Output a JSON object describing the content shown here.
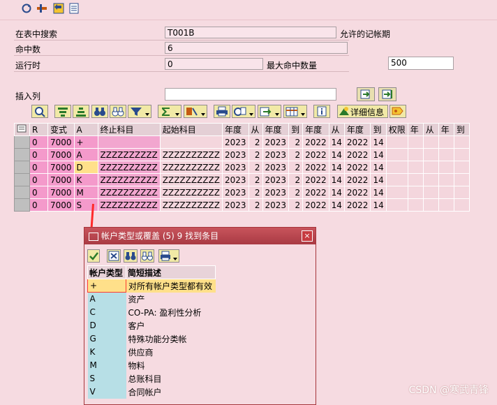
{
  "toolbar_icons": [
    "refresh-icon",
    "tools-icon",
    "back-icon",
    "list-icon"
  ],
  "form": {
    "search_label": "在表中搜索",
    "search_value": "T001B",
    "allowed_period_label": "允许的记帐期",
    "hits_label": "命中数",
    "hits_value": "6",
    "runtime_label": "运行时",
    "runtime_value": "0",
    "max_hits_label": "最大命中数量",
    "max_hits_value": "500",
    "insert_col_label": "插入列",
    "insert_col_value": ""
  },
  "alv_toolbar": {
    "detail_label": "详细信息"
  },
  "grid": {
    "headers": [
      "R",
      "变式",
      "A",
      "终止科目",
      "起始科目",
      "年度",
      "从",
      "年度",
      "到",
      "年度",
      "从",
      "年度",
      "到",
      "权限",
      "年",
      "从",
      "年",
      "到"
    ],
    "rows": [
      [
        "0",
        "7000",
        "+",
        "",
        "",
        "2023",
        "2",
        "2023",
        "2",
        "2022",
        "14",
        "2022",
        "14",
        "",
        "",
        "",
        "",
        ""
      ],
      [
        "0",
        "7000",
        "A",
        "ZZZZZZZZZZ",
        "ZZZZZZZZZZ",
        "2023",
        "2",
        "2023",
        "2",
        "2022",
        "14",
        "2022",
        "14",
        "",
        "",
        "",
        "",
        ""
      ],
      [
        "0",
        "7000",
        "D",
        "ZZZZZZZZZZ",
        "ZZZZZZZZZZ",
        "2023",
        "2",
        "2023",
        "2",
        "2022",
        "14",
        "2022",
        "14",
        "",
        "",
        "",
        "",
        ""
      ],
      [
        "0",
        "7000",
        "K",
        "ZZZZZZZZZZ",
        "ZZZZZZZZZZ",
        "2023",
        "2",
        "2023",
        "2",
        "2022",
        "14",
        "2022",
        "14",
        "",
        "",
        "",
        "",
        ""
      ],
      [
        "0",
        "7000",
        "M",
        "ZZZZZZZZZZ",
        "ZZZZZZZZZZ",
        "2023",
        "2",
        "2023",
        "2",
        "2022",
        "14",
        "2022",
        "14",
        "",
        "",
        "",
        "",
        ""
      ],
      [
        "0",
        "7000",
        "S",
        "ZZZZZZZZZZ",
        "ZZZZZZZZZZ",
        "2023",
        "2",
        "2023",
        "2",
        "2022",
        "14",
        "2022",
        "14",
        "",
        "",
        "",
        "",
        ""
      ]
    ]
  },
  "popup": {
    "title": "帐户类型或覆盖 (5)   9 找到条目",
    "col1": "帐户类型",
    "col2": "简短描述",
    "items": [
      {
        "code": "+",
        "desc": "对所有帐户类型都有效"
      },
      {
        "code": "A",
        "desc": "资产"
      },
      {
        "code": "C",
        "desc": "CO-PA: 盈利性分析"
      },
      {
        "code": "D",
        "desc": "客户"
      },
      {
        "code": "G",
        "desc": "特殊功能分类帐"
      },
      {
        "code": "K",
        "desc": "供应商"
      },
      {
        "code": "M",
        "desc": "物料"
      },
      {
        "code": "S",
        "desc": "总账科目"
      },
      {
        "code": "V",
        "desc": "合同帐户"
      }
    ]
  },
  "watermark": "CSDN @寒武青锋"
}
